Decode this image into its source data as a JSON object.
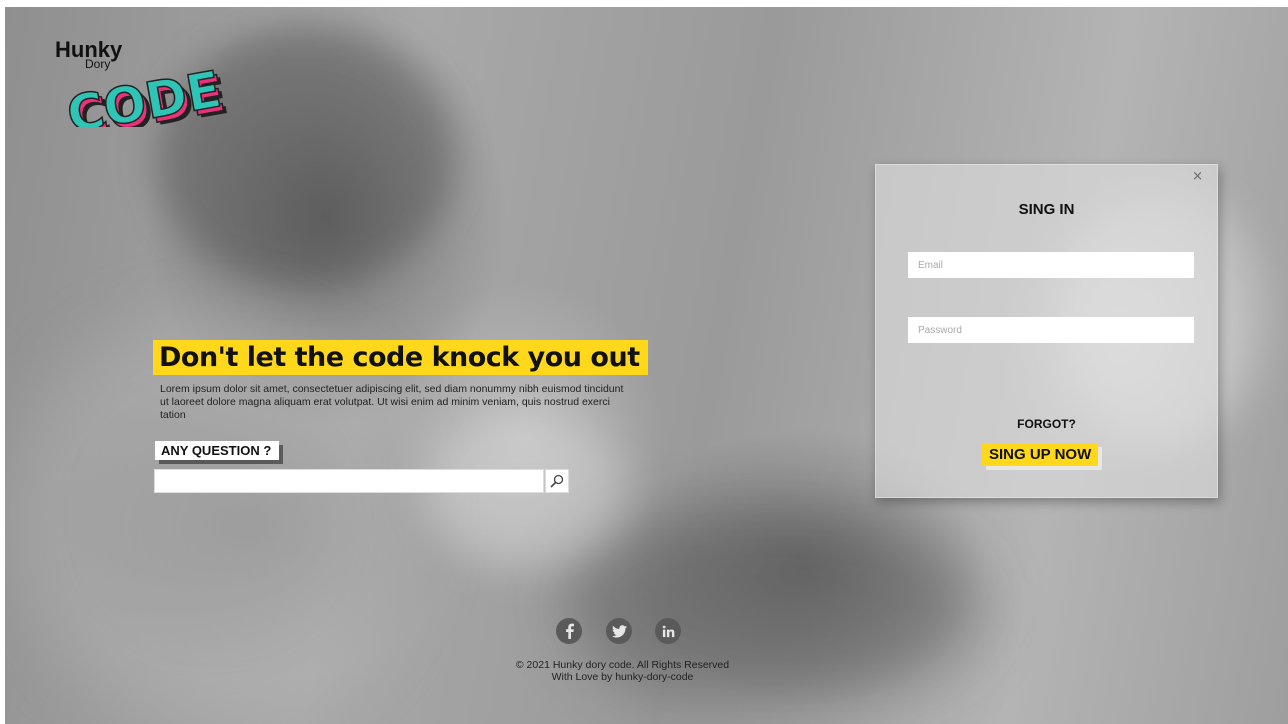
{
  "logo": {
    "line1": "Hunky",
    "line2": "Dory",
    "line3": "CODE",
    "colors": {
      "pink": "#e8327a",
      "teal": "#2ec4b6",
      "shadow": "#222222"
    }
  },
  "hero": {
    "headline": "Don't let the code knock you out",
    "body": "Lorem ipsum dolor sit amet, consectetuer adipiscing elit, sed diam nonummy nibh euismod tincidunt ut laoreet dolore magna aliquam erat volutpat. Ut wisi enim ad minim veniam, quis nostrud exerci tation",
    "question_label": "ANY QUESTION ?",
    "search_icon": "search-icon",
    "accent": "#ffd81c"
  },
  "signin": {
    "close": "×",
    "title": "SING IN",
    "email_placeholder": "Email",
    "password_placeholder": "Password",
    "forgot": "FORGOT?",
    "signup": "SING UP NOW"
  },
  "social": {
    "facebook": "facebook-icon",
    "twitter": "twitter-icon",
    "linkedin": "linkedin-icon"
  },
  "footer": {
    "copyright": "© 2021 Hunky dory code. All Rights Reserved",
    "credit": "With Love by hunky-dory-code"
  }
}
